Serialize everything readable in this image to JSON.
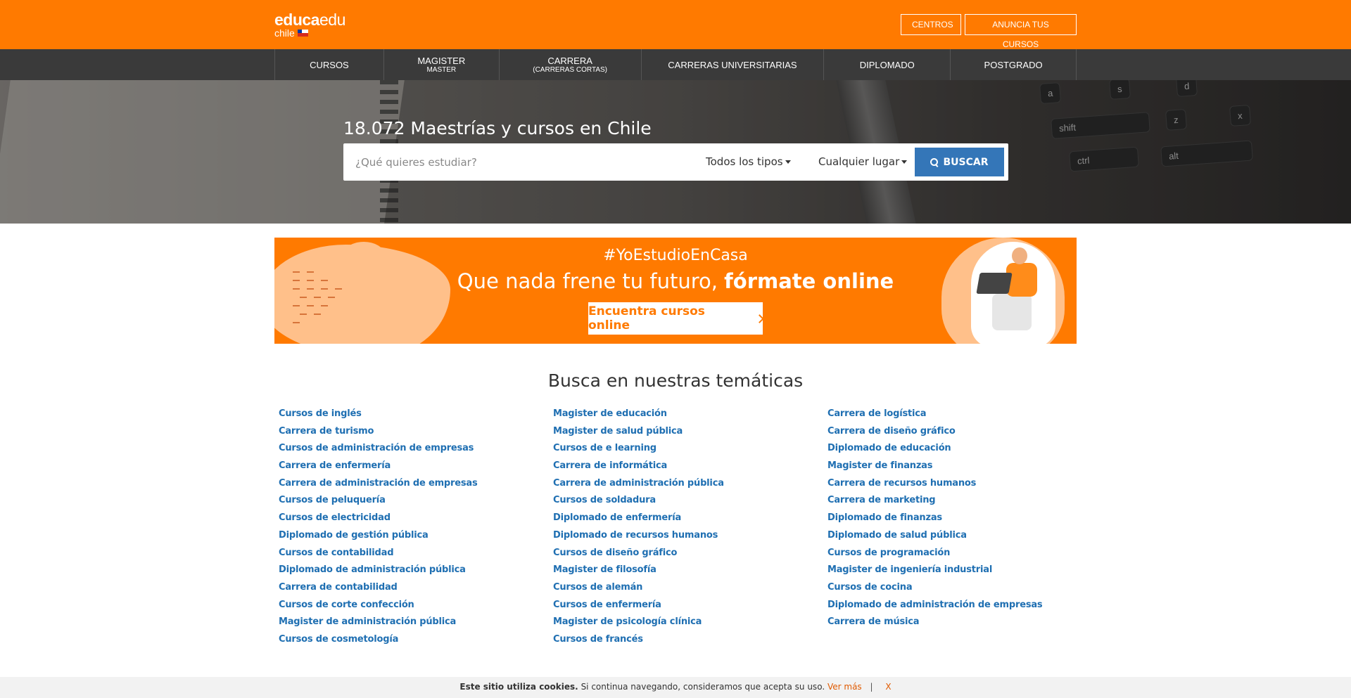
{
  "header": {
    "logo_bold": "educa",
    "logo_light": "edu",
    "country": "chile",
    "centros_label": "CENTROS",
    "anuncia_label": "ANUNCIA TUS CURSOS"
  },
  "nav": [
    {
      "label": "CURSOS",
      "sub": ""
    },
    {
      "label": "MAGISTER",
      "sub": "MASTER"
    },
    {
      "label": "CARRERA",
      "sub": "(CARRERAS CORTAS)"
    },
    {
      "label": "CARRERAS UNIVERSITARIAS",
      "sub": ""
    },
    {
      "label": "DIPLOMADO",
      "sub": ""
    },
    {
      "label": "POSTGRADO",
      "sub": ""
    }
  ],
  "hero": {
    "title": "18.072 Maestrías y cursos en Chile",
    "search_placeholder": "¿Qué quieres estudiar?",
    "type_select": "Todos los tipos",
    "place_select": "Cualquier lugar",
    "search_button": "BUSCAR",
    "keys": [
      "a",
      "s",
      "d",
      "shift",
      "z",
      "x",
      "ctrl",
      "alt"
    ]
  },
  "banner": {
    "hashtag": "#YoEstudioEnCasa",
    "heading_regular": "Que nada frene tu futuro,",
    "heading_bold": "fórmate online",
    "button": "Encuentra cursos online"
  },
  "topics": {
    "title": "Busca en nuestras temáticas",
    "col1": [
      "Cursos de inglés",
      "Carrera de turismo",
      "Cursos de administración de empresas",
      "Carrera de enfermería",
      "Carrera de administración de empresas",
      "Cursos de peluquería",
      "Cursos de electricidad",
      "Diplomado de gestión pública",
      "Cursos de contabilidad",
      "Diplomado de administración pública",
      "Carrera de contabilidad",
      "Cursos de corte confección",
      "Magister de administración pública",
      "Cursos de cosmetología"
    ],
    "col2": [
      "Magister de educación",
      "Magister de salud pública",
      "Cursos de e learning",
      "Carrera de informática",
      "Carrera de administración pública",
      "Cursos de soldadura",
      "Diplomado de enfermería",
      "Diplomado de recursos humanos",
      "Cursos de diseño gráfico",
      "Magister de filosofía",
      "Cursos de alemán",
      "Cursos de enfermería",
      "Magister de psicología clínica",
      "Cursos de francés"
    ],
    "col3": [
      "Carrera de logística",
      "Carrera de diseño gráfico",
      "Diplomado de educación",
      "Magister de finanzas",
      "Carrera de recursos humanos",
      "Carrera de marketing",
      "Diplomado de finanzas",
      "Diplomado de salud pública",
      "Cursos de programación",
      "Magister de ingeniería industrial",
      "Cursos de cocina",
      "Diplomado de administración de empresas",
      "Carrera de música"
    ]
  },
  "cookie": {
    "bold": "Este sitio utiliza cookies.",
    "text": "Si continua navegando, consideramos que acepta su uso.",
    "link": "Ver más",
    "separator": "|",
    "close": "X"
  }
}
